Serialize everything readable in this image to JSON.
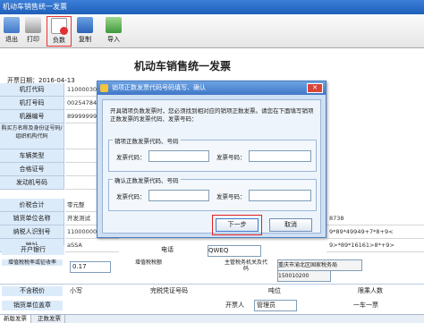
{
  "window": {
    "title": "机动车销售统一发票"
  },
  "toolbar": {
    "items": [
      {
        "label": "退出"
      },
      {
        "label": "打印"
      },
      {
        "label": "负数"
      },
      {
        "label": "复制"
      },
      {
        "label": "导入"
      }
    ]
  },
  "invoice": {
    "title": "机动车销售统一发票",
    "date_label": "开票日期：",
    "date_value": "2016-04-13",
    "rows": [
      {
        "label": "机打代码",
        "value": "11000030"
      },
      {
        "label": "机打号码",
        "value": "00254784"
      },
      {
        "label": "机器编号",
        "value": "89999999"
      },
      {
        "label": "购买方名称及身份证号码/组织机构代码",
        "value": ""
      },
      {
        "label": "车辆类型",
        "value": ""
      },
      {
        "label": "合格证号",
        "value": ""
      },
      {
        "label": "发动机号码",
        "value": ""
      },
      {
        "label": "价税合计",
        "value": "零元整"
      },
      {
        "label": "销货单位名称",
        "value": "开发测试"
      },
      {
        "label": "纳税人识别号",
        "value": "1100000000"
      },
      {
        "label": "地址",
        "value": "aSSA"
      }
    ],
    "right_values": [
      "8738",
      "9*89*49949+7*8+9<",
      "9>*89*16161>8*+9>",
      "QWEQ",
      "重庆市渝北区国家税务局",
      "150010200"
    ],
    "bottom": {
      "tax_rate_label": "增值税税率或征收率",
      "tax_rate_value": "0.17",
      "tax_amount_label": "增值税税额",
      "tax_office_label": "主管税务机关及代码",
      "excl_tax_label": "不含税价",
      "unit_label": "小写",
      "cert_label": "完税凭证号码",
      "tonnage_label": "吨位",
      "passengers_label": "限乘人数",
      "seller_label": "销货单位盖章",
      "drawer_label": "开票人",
      "drawer_value": "管理员",
      "note_value": "一车一票",
      "account_label": "开户银行",
      "phone_label": "电话"
    }
  },
  "tabs": [
    "新版发票",
    "正数发票"
  ],
  "dialog": {
    "title": "销项正数发票代码号码填写、确认",
    "message": "开具销项负数发票时，您必须找到相对应的销项正数发票。请您在下面填写销项正数发票的发票代码、发票号码：",
    "group1_label": "销项正数发票代码、号码",
    "group2_label": "确认正数发票代码、号码",
    "code_label": "发票代码：",
    "number_label": "发票号码：",
    "next_button": "下一步",
    "cancel_button": "取消"
  },
  "colors": {
    "accent": "#3f78c8",
    "highlight": "#e02020"
  }
}
